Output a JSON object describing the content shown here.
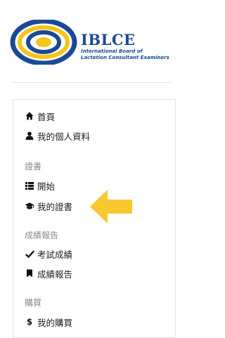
{
  "brand": {
    "name": "IBLCE",
    "subtitle_line1": "International Board of",
    "subtitle_line2": "Lactation Consultant Examiners"
  },
  "colors": {
    "brand_blue": "#1a4a94",
    "brand_yellow": "#f5c518",
    "arrow": "#f7c830"
  },
  "nav": {
    "home": "首頁",
    "profile": "我的個人資料",
    "certificate_section": "證書",
    "start": "開始",
    "my_certificates": "我的證書",
    "reports_section": "成績報告",
    "exam_results": "考試成績",
    "score_report": "成績報告",
    "purchase_section": "購買",
    "my_purchases": "我的購買"
  },
  "icons": {
    "home": "home-icon",
    "profile": "user-icon",
    "start": "list-icon",
    "certificates": "graduation-cap-icon",
    "exam_results": "check-icon",
    "score_report": "bookmark-icon",
    "purchases": "dollar-icon",
    "annotation": "yellow-arrow-left"
  }
}
